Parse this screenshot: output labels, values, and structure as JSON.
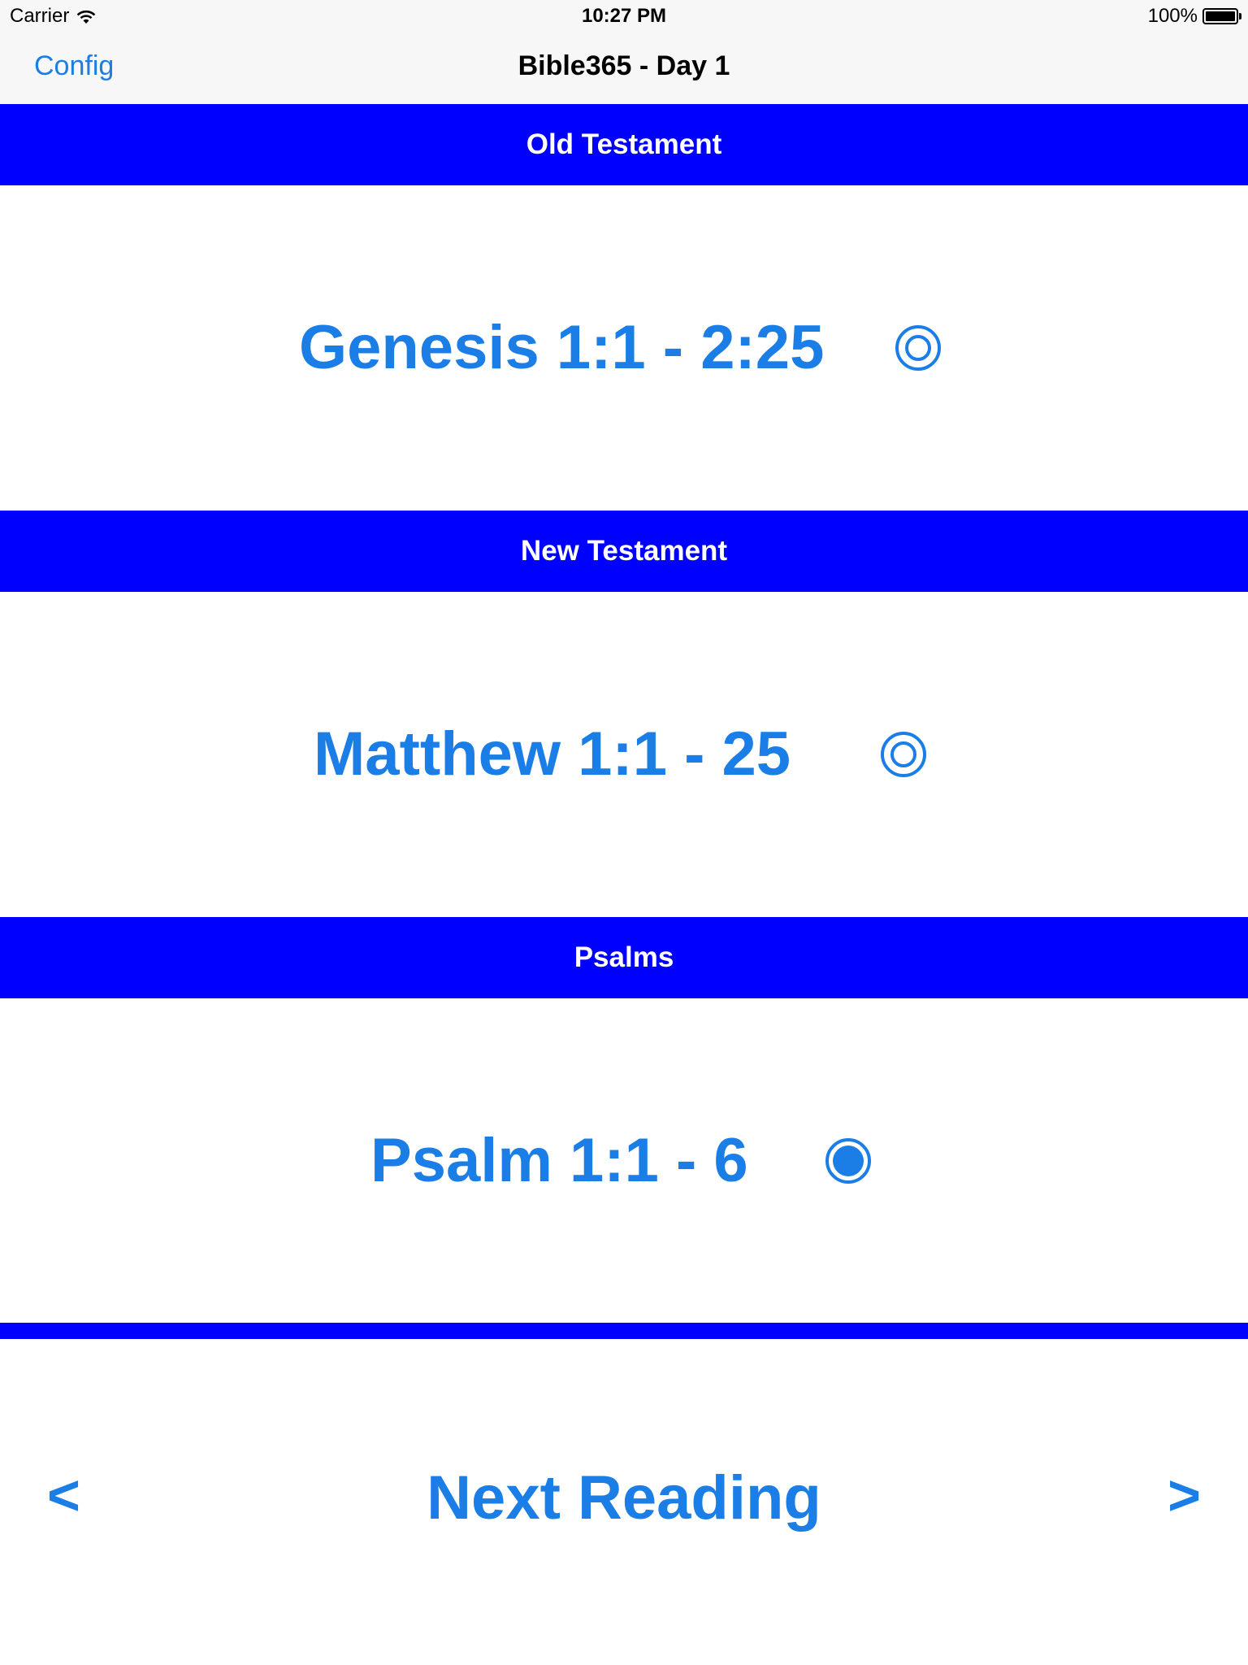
{
  "status_bar": {
    "carrier": "Carrier",
    "time": "10:27 PM",
    "battery": "100%",
    "wifi_icon": "wifi-icon",
    "battery_icon": "battery-icon"
  },
  "nav": {
    "left_button": "Config",
    "title": "Bible365 - Day 1"
  },
  "sections": [
    {
      "header": "Old Testament",
      "reading": "Genesis 1:1 - 2:25",
      "checked": false
    },
    {
      "header": "New Testament",
      "reading": "Matthew 1:1 - 25",
      "checked": false
    },
    {
      "header": "Psalms",
      "reading": "Psalm 1:1 - 6",
      "checked": true
    }
  ],
  "bottom": {
    "prev": "<",
    "next_reading": "Next Reading",
    "next": ">"
  },
  "colors": {
    "header_bg": "#0000ff",
    "accent": "#1a7ee6",
    "bar_bg": "#f7f7f7"
  }
}
